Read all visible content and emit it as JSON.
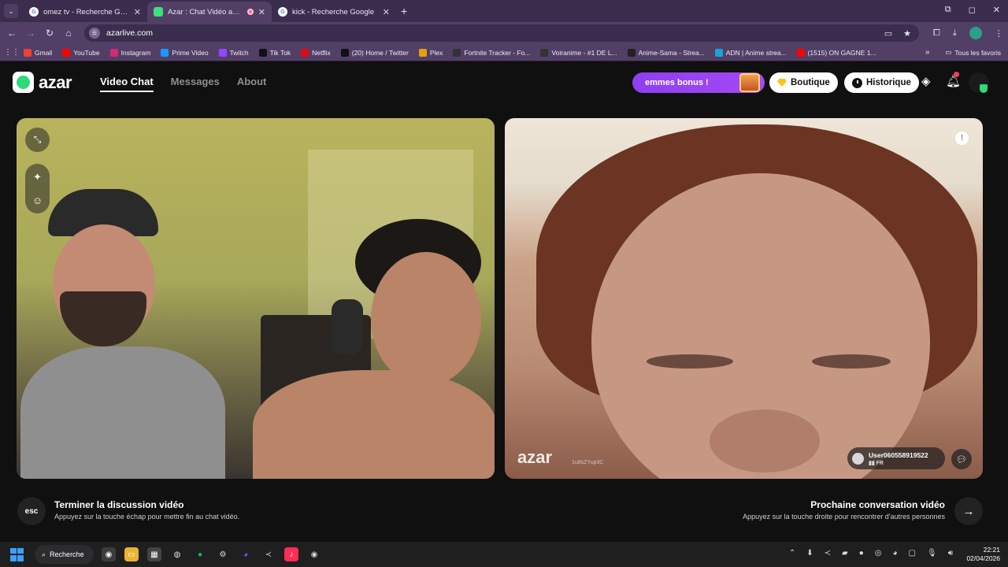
{
  "browser": {
    "tabs": [
      {
        "title": "omez tv - Recherche Google",
        "active": false
      },
      {
        "title": "Azar : Chat Vidéo avec de n",
        "active": true
      },
      {
        "title": "kick - Recherche Google",
        "active": false
      }
    ],
    "url": "azarlive.com",
    "bookmarks": [
      {
        "label": "Gmail",
        "color": "#ea4335"
      },
      {
        "label": "YouTube",
        "color": "#ff0000"
      },
      {
        "label": "Instagram",
        "color": "#d62976"
      },
      {
        "label": "Prime Video",
        "color": "#1a98ff"
      },
      {
        "label": "Twitch",
        "color": "#9146ff"
      },
      {
        "label": "Tik Tok",
        "color": "#111111"
      },
      {
        "label": "Netflix",
        "color": "#e50914"
      },
      {
        "label": "(20) Home / Twitter",
        "color": "#111111"
      },
      {
        "label": "Plex",
        "color": "#e5a00d"
      },
      {
        "label": "Fortnite Tracker - Fo...",
        "color": "#333333"
      },
      {
        "label": "Voiranime - #1 DE L...",
        "color": "#333333"
      },
      {
        "label": "Anime-Sama - Strea...",
        "color": "#222222"
      },
      {
        "label": "ADN | Anime strea...",
        "color": "#1aa3d9"
      },
      {
        "label": "(1515) ON GAGNE 1...",
        "color": "#ff0000"
      }
    ],
    "all_bookmarks": "Tous les favoris"
  },
  "azar": {
    "logo": "azar",
    "nav": [
      "Video Chat",
      "Messages",
      "About"
    ],
    "bonus": "emmes bonus !",
    "shop": "Boutique",
    "history": "Historique",
    "notif_count": "1"
  },
  "remote": {
    "watermark": "azar",
    "session_id": "1u8sZYup3C",
    "username": "User060558919522",
    "country": "FR"
  },
  "actions": {
    "esc_key": "esc",
    "end_title": "Terminer la discussion vidéo",
    "end_sub": "Appuyez sur la touche échap pour mettre fin au chat vidéo.",
    "next_title": "Prochaine conversation vidéo",
    "next_sub": "Appuyez sur la touche droite pour rencontrer d'autres personnes"
  },
  "taskbar": {
    "search": "Recherche",
    "time": "22:21",
    "date": "02/04/2026"
  }
}
